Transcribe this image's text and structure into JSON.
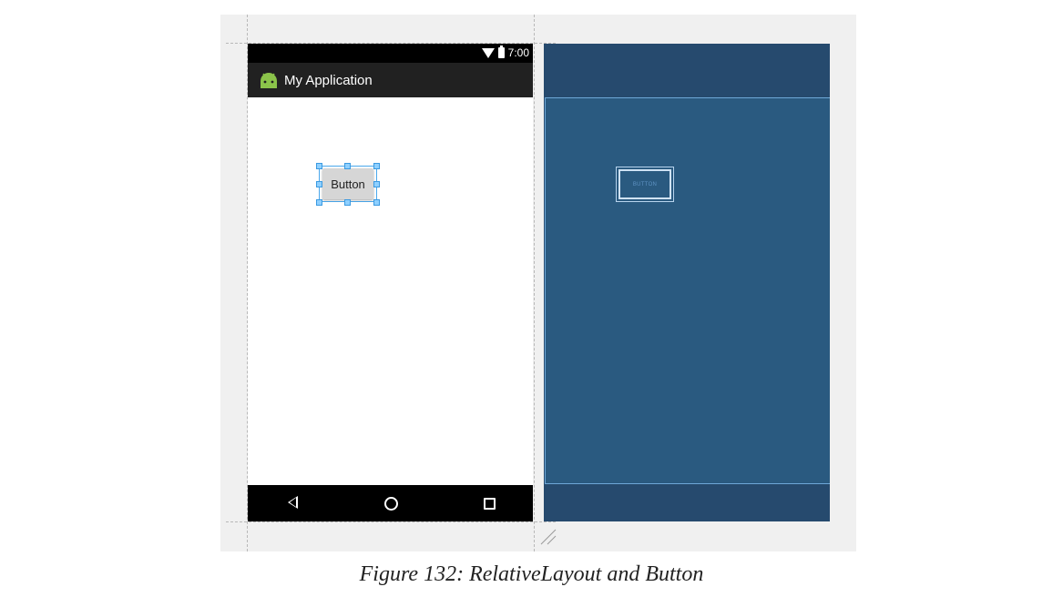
{
  "status_bar": {
    "time": "7:00"
  },
  "action_bar": {
    "title": "My Application"
  },
  "design_button": {
    "label": "Button"
  },
  "blueprint_button": {
    "label": "BUTTON"
  },
  "navigation": {
    "back": "back-icon",
    "home": "home-icon",
    "recents": "recents-icon"
  },
  "caption": "Figure 132: RelativeLayout and Button",
  "colors": {
    "blueprint_bg": "#264a6e",
    "blueprint_content": "#2a5a80",
    "selection": "#4aa8ec",
    "android_green": "#8bc34a"
  }
}
